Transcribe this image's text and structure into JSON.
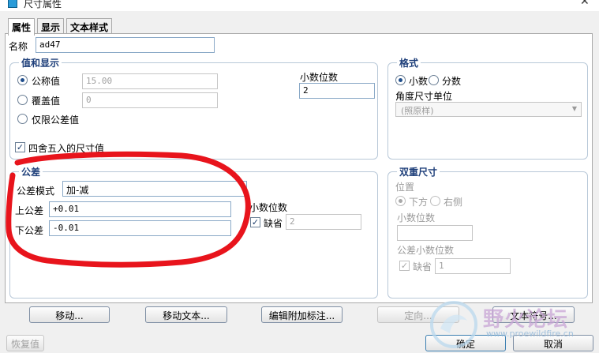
{
  "window": {
    "title": "尺寸属性",
    "close_glyph": "✕"
  },
  "tabs": [
    {
      "label": "属性",
      "active": true
    },
    {
      "label": "显示",
      "active": false
    },
    {
      "label": "文本样式",
      "active": false
    }
  ],
  "name_field": {
    "label": "名称",
    "value": "ad47"
  },
  "value_display": {
    "title": "值和显示",
    "nominal": {
      "label": "公称值",
      "value": "15.00",
      "selected": true
    },
    "override": {
      "label": "覆盖值",
      "value": "0",
      "selected": false
    },
    "tolerance_only": {
      "label": "仅限公差值",
      "selected": false
    },
    "decimal_places": {
      "label": "小数位数",
      "value": "2"
    },
    "rounded": {
      "label": "四舍五入的尺寸值",
      "checked": true
    }
  },
  "format": {
    "title": "格式",
    "decimal": {
      "label": "小数",
      "selected": true
    },
    "fraction": {
      "label": "分数",
      "selected": false
    },
    "angular_unit": {
      "label": "角度尺寸单位",
      "value": "(照原样)"
    }
  },
  "tolerance": {
    "title": "公差",
    "mode": {
      "label": "公差模式",
      "value": "加-减"
    },
    "upper": {
      "label": "上公差",
      "value": "+0.01"
    },
    "lower": {
      "label": "下公差",
      "value": "-0.01"
    },
    "decimal_places": {
      "label": "小数位数"
    },
    "default": {
      "label": "缺省",
      "checked": true,
      "value": "2"
    }
  },
  "dual_dimension": {
    "title": "双重尺寸",
    "position": {
      "label": "位置"
    },
    "below": {
      "label": "下方",
      "selected": true
    },
    "right": {
      "label": "右侧",
      "selected": false
    },
    "decimal_places": {
      "label": "小数位数",
      "value": ""
    },
    "tol_decimal_places": {
      "label": "公差小数位数"
    },
    "default": {
      "label": "缺省",
      "checked": true,
      "value": "1"
    }
  },
  "buttons": {
    "move": "移动...",
    "move_text": "移动文本...",
    "edit_attached_note": "编辑附加标注...",
    "orient": "定向...",
    "text_symbol": "文本符号...",
    "restore": "恢复值",
    "ok": "确定",
    "cancel": "取消"
  },
  "watermark": {
    "text": "野火论坛",
    "url": "www.proewildfire.cn"
  },
  "colors": {
    "annotation_red": "#e8141c",
    "group_title": "#1e3f7a",
    "accent_blue": "#2a9bd8"
  },
  "icons": {
    "window": "app-window-icon",
    "close": "close-icon",
    "dropdown": "chevron-down-icon",
    "watermark": "forum-logo-icon"
  }
}
